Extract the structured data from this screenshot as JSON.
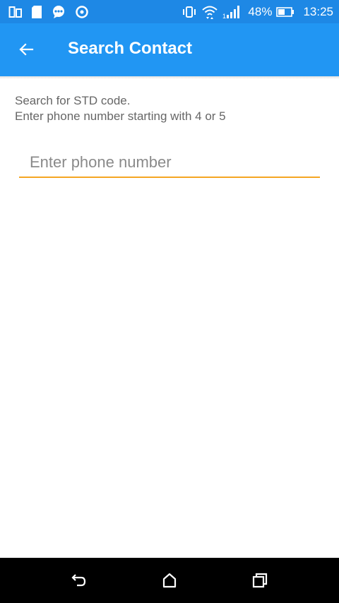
{
  "status_bar": {
    "battery_percent": "48%",
    "time": "13:25",
    "left_icons": [
      "dual-window-icon",
      "sd-card-icon",
      "messenger-icon",
      "sync-icon"
    ],
    "right_icons": [
      "vibrate-icon",
      "wifi-icon",
      "signal-icon",
      "battery-icon"
    ]
  },
  "app_bar": {
    "title": "Search Contact",
    "back_icon": "arrow-left-icon"
  },
  "content": {
    "instruction_line1": "Search for STD code.",
    "instruction_line2": "Enter phone number starting with 4 or 5",
    "phone_input": {
      "value": "",
      "placeholder": "Enter phone number"
    }
  },
  "nav_bar": {
    "icons": [
      "back-icon",
      "home-icon",
      "recents-icon"
    ]
  },
  "colors": {
    "status_bar": "#1e88e5",
    "app_bar": "#2196f3",
    "accent": "#f5a623",
    "instruction_text": "#666666",
    "nav_bar": "#000000"
  }
}
